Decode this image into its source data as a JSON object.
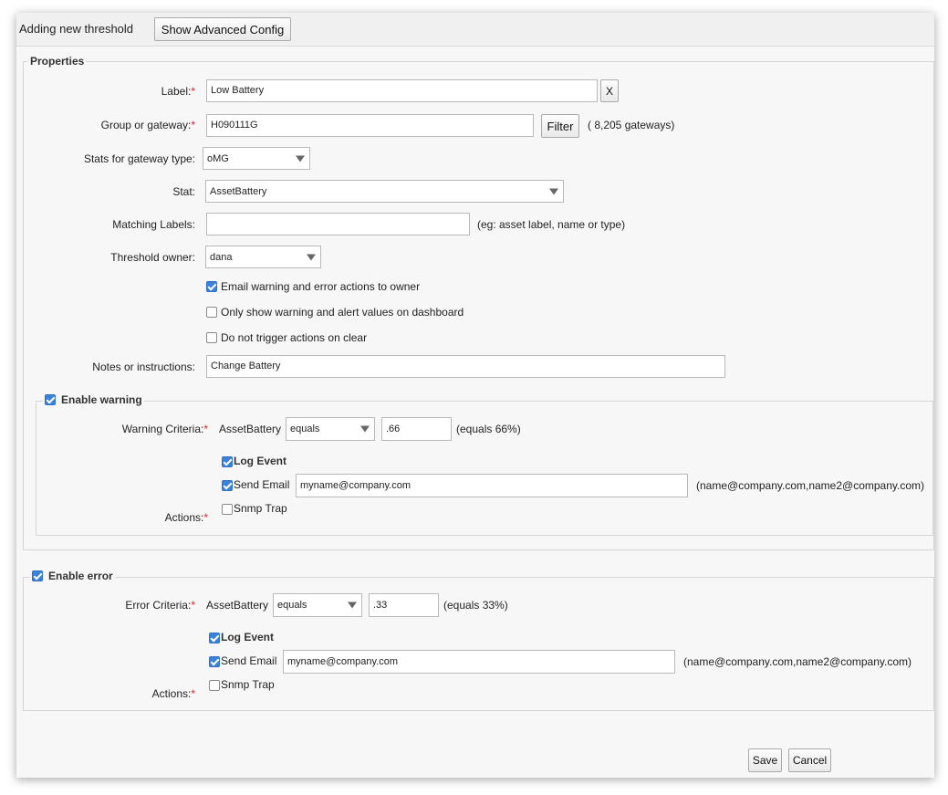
{
  "header": {
    "title": "Adding new threshold",
    "advanced_button": "Show Advanced Config"
  },
  "properties": {
    "legend": "Properties",
    "label": {
      "label": "Label:",
      "value": "Low Battery",
      "clear_button": "X"
    },
    "group": {
      "label": "Group or gateway:",
      "value": "H090111G",
      "filter_button": "Filter",
      "count_text": "( 8,205 gateways)"
    },
    "gateway_type": {
      "label": "Stats for gateway type:",
      "value": "oMG"
    },
    "stat": {
      "label": "Stat:",
      "value": "AssetBattery"
    },
    "matching_labels": {
      "label": "Matching Labels:",
      "value": "",
      "hint": "(eg: asset label, name or type)"
    },
    "owner": {
      "label": "Threshold owner:",
      "value": "dana"
    },
    "options": [
      {
        "label": "Email warning and error actions to owner",
        "checked": true
      },
      {
        "label": "Only show warning and alert values on dashboard",
        "checked": false
      },
      {
        "label": "Do not trigger actions on clear",
        "checked": false
      }
    ],
    "notes": {
      "label": "Notes or instructions:",
      "value": "Change Battery"
    }
  },
  "warning": {
    "legend": "Enable warning",
    "enabled": true,
    "criteria_label": "Warning Criteria:",
    "stat": "AssetBattery",
    "operator": "equals",
    "value": ".66",
    "equals_text": "(equals 66%)",
    "actions_label": "Actions:",
    "log_event": {
      "label": "Log Event",
      "checked": true
    },
    "send_email": {
      "label": "Send Email",
      "checked": true,
      "value": "myname@company.com",
      "hint": "(name@company.com,name2@company.com)"
    },
    "snmp_trap": {
      "label": "Snmp Trap",
      "checked": false
    }
  },
  "error": {
    "legend": "Enable error",
    "enabled": true,
    "criteria_label": "Error Criteria:",
    "stat": "AssetBattery",
    "operator": "equals",
    "value": ".33",
    "equals_text": "(equals 33%)",
    "actions_label": "Actions:",
    "log_event": {
      "label": "Log Event",
      "checked": true
    },
    "send_email": {
      "label": "Send Email",
      "checked": true,
      "value": "myname@company.com",
      "hint": "(name@company.com,name2@company.com)"
    },
    "snmp_trap": {
      "label": "Snmp Trap",
      "checked": false
    }
  },
  "footer": {
    "save": "Save",
    "cancel": "Cancel"
  },
  "colors": {
    "accent": "#3b82dd",
    "required": "#dd2222"
  }
}
